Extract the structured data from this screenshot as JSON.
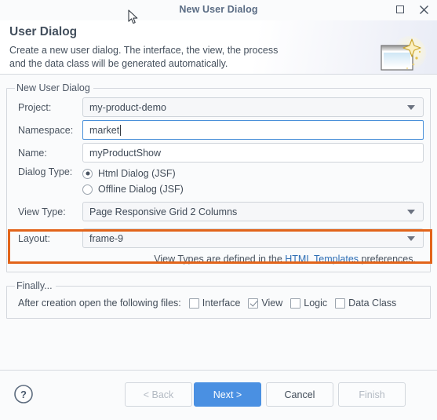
{
  "window": {
    "title": "New User Dialog",
    "maximize_label": "Maximize",
    "close_label": "Close"
  },
  "header": {
    "title": "User Dialog",
    "description_line1": "Create a new user dialog. The interface, the view, the process",
    "description_line2": "and the data class will be generated automatically.",
    "icon": "new-dialog-wizard-icon"
  },
  "form": {
    "legend": "New User Dialog",
    "project": {
      "label": "Project:",
      "value": "my-product-demo"
    },
    "namespace": {
      "label": "Namespace:",
      "value": "market"
    },
    "name": {
      "label": "Name:",
      "value": "myProductShow"
    },
    "dialog_type": {
      "label": "Dialog Type:",
      "options": [
        {
          "label": "Html Dialog (JSF)",
          "selected": true
        },
        {
          "label": "Offline Dialog (JSF)",
          "selected": false
        }
      ]
    },
    "view_type": {
      "label": "View Type:",
      "value": "Page Responsive Grid 2 Columns"
    },
    "layout": {
      "label": "Layout:",
      "value": "frame-9"
    },
    "hint": {
      "before": "View Types are defined in the ",
      "link": "HTML Templates",
      "after": " preferences."
    }
  },
  "finally_group": {
    "legend": "Finally...",
    "prompt": "After creation open the following files:",
    "checkboxes": [
      {
        "label": "Interface",
        "checked": false
      },
      {
        "label": "View",
        "checked": true
      },
      {
        "label": "Logic",
        "checked": false
      },
      {
        "label": "Data Class",
        "checked": false
      }
    ]
  },
  "footer": {
    "help_label": "Help",
    "buttons": [
      {
        "label": "< Back",
        "state": "disabled"
      },
      {
        "label": "Next >",
        "state": "primary"
      },
      {
        "label": "Cancel",
        "state": "normal"
      },
      {
        "label": "Finish",
        "state": "disabled"
      }
    ]
  },
  "annotation": {
    "highlight_color": "#e2641a",
    "highlight_target": "layout-row"
  }
}
